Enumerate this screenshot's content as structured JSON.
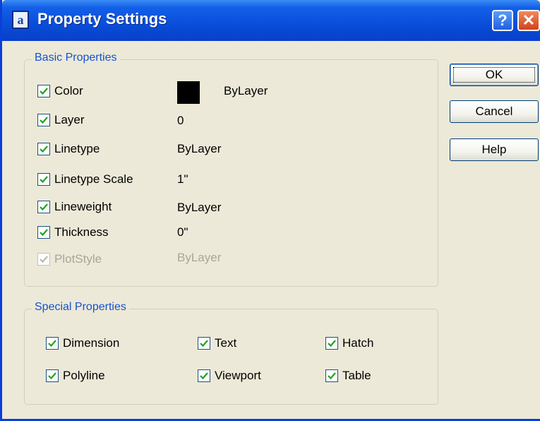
{
  "window": {
    "title": "Property Settings",
    "help_label": "?",
    "close_label": "✕"
  },
  "basic_properties": {
    "title": "Basic Properties",
    "items": [
      {
        "label": "Color",
        "value": "ByLayer",
        "checked": true,
        "swatch_color": "#000000"
      },
      {
        "label": "Layer",
        "value": "0",
        "checked": true
      },
      {
        "label": "Linetype",
        "value": "ByLayer",
        "checked": true
      },
      {
        "label": "Linetype Scale",
        "value": "1\"",
        "checked": true
      },
      {
        "label": "Lineweight",
        "value": "ByLayer",
        "checked": true
      },
      {
        "label": "Thickness",
        "value": "0\"",
        "checked": true
      },
      {
        "label": "PlotStyle",
        "value": "ByLayer",
        "checked": true,
        "disabled": true
      }
    ]
  },
  "special_properties": {
    "title": "Special Properties",
    "items": [
      {
        "label": "Dimension",
        "checked": true
      },
      {
        "label": "Text",
        "checked": true
      },
      {
        "label": "Hatch",
        "checked": true
      },
      {
        "label": "Polyline",
        "checked": true
      },
      {
        "label": "Viewport",
        "checked": true
      },
      {
        "label": "Table",
        "checked": true
      }
    ]
  },
  "buttons": {
    "ok": "OK",
    "cancel": "Cancel",
    "help": "Help"
  },
  "colors": {
    "titlebar": "#0a4fdc",
    "group_title": "#1553d0",
    "check": "#21a121",
    "dialog_bg": "#ece9d8"
  }
}
